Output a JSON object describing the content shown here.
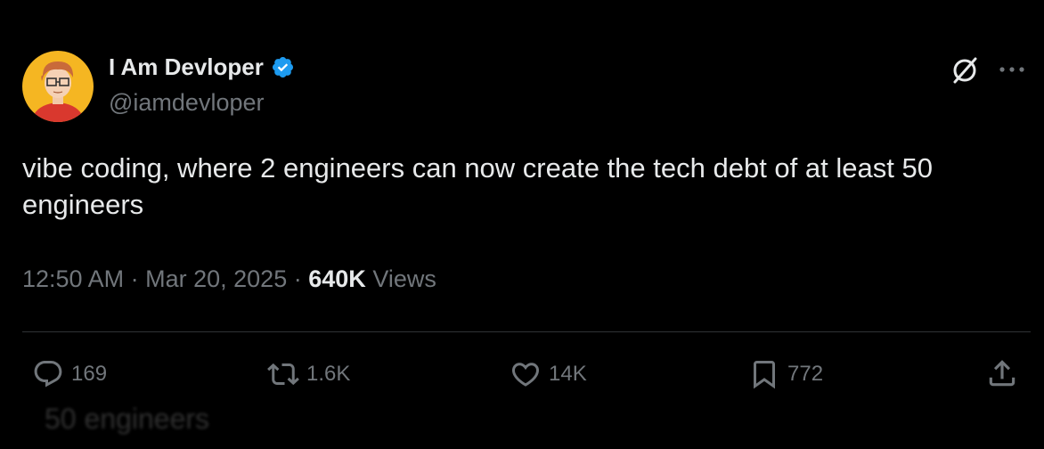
{
  "background_faded": {
    "bottom_text": "50 engineers"
  },
  "author": {
    "display_name": "I Am Devloper",
    "handle": "@iamdevloper",
    "verified": true,
    "verified_color": "#1d9bf0"
  },
  "tweet": {
    "text": "vibe coding, where 2 engineers can now create the tech debt of at least 50 engineers",
    "time": "12:50 AM",
    "separator": "·",
    "date": "Mar 20, 2025",
    "views_count": "640K",
    "views_label": "Views"
  },
  "actions": {
    "replies": "169",
    "reposts": "1.6K",
    "likes": "14K",
    "bookmarks": "772"
  },
  "icons": {
    "reply": "reply-icon",
    "repost": "repost-icon",
    "like": "heart-icon",
    "bookmark": "bookmark-icon",
    "share": "share-icon",
    "grok": "grok-icon",
    "more": "more-icon"
  },
  "colors": {
    "background": "#000000",
    "text_primary": "#e7e9ea",
    "text_secondary": "#71767b",
    "divider": "#2f3336"
  }
}
